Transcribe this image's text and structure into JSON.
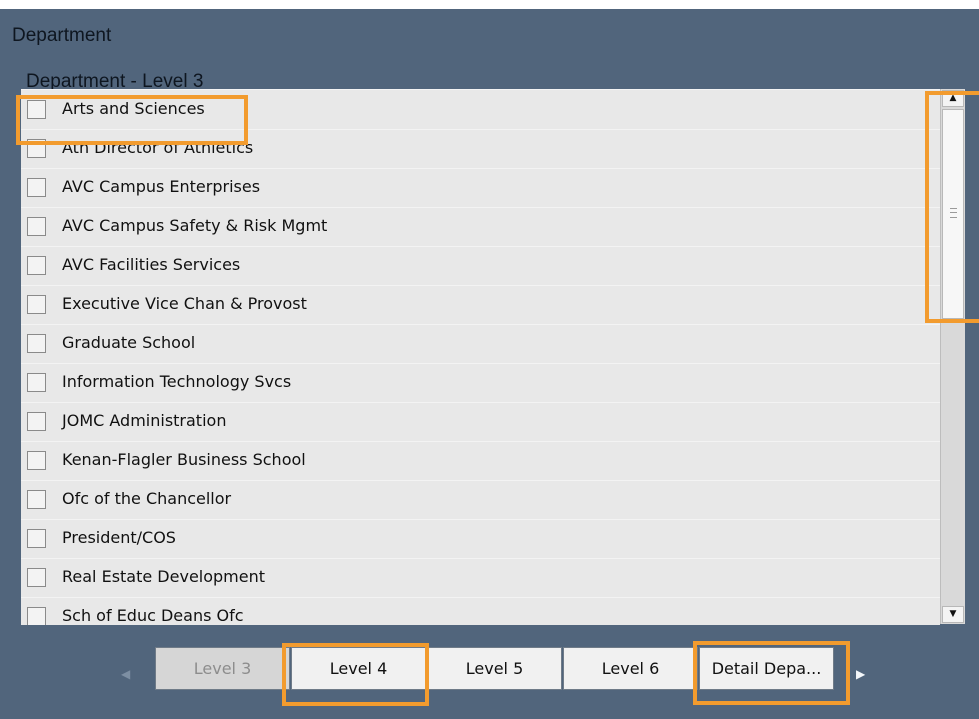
{
  "panel": {
    "title": "Department",
    "subtitle": "Department - Level 3"
  },
  "list": {
    "items": [
      {
        "label": "Arts and Sciences",
        "checked": false,
        "highlighted": true
      },
      {
        "label": "Ath Director of Athletics",
        "checked": false
      },
      {
        "label": "AVC Campus Enterprises",
        "checked": false
      },
      {
        "label": "AVC Campus Safety & Risk Mgmt",
        "checked": false
      },
      {
        "label": "AVC Facilities Services",
        "checked": false
      },
      {
        "label": "Executive Vice Chan & Provost",
        "checked": false
      },
      {
        "label": "Graduate School",
        "checked": false
      },
      {
        "label": "Information Technology Svcs",
        "checked": false
      },
      {
        "label": "JOMC Administration",
        "checked": false
      },
      {
        "label": "Kenan-Flagler Business School",
        "checked": false
      },
      {
        "label": "Ofc of the Chancellor",
        "checked": false
      },
      {
        "label": "President/COS",
        "checked": false
      },
      {
        "label": "Real Estate Development",
        "checked": false
      },
      {
        "label": "Sch of Educ Deans Ofc",
        "checked": false
      }
    ]
  },
  "scrollbar": {
    "up_icon": "triangle-up-icon",
    "down_icon": "triangle-down-icon",
    "up_glyph": "▲",
    "down_glyph": "▼"
  },
  "tabs": {
    "items": [
      {
        "label": "Level 3",
        "enabled": false
      },
      {
        "label": "Level 4",
        "enabled": true,
        "highlighted": true
      },
      {
        "label": "Level 5",
        "enabled": true
      },
      {
        "label": "Level 6",
        "enabled": true
      },
      {
        "label": "Detail Depa...",
        "enabled": true,
        "highlighted": true
      }
    ],
    "prev_glyph": "◀",
    "next_glyph": "▶"
  },
  "colors": {
    "panel_background": "#51657c",
    "list_background": "#e8e8e8",
    "highlight": "#f29b2e"
  }
}
